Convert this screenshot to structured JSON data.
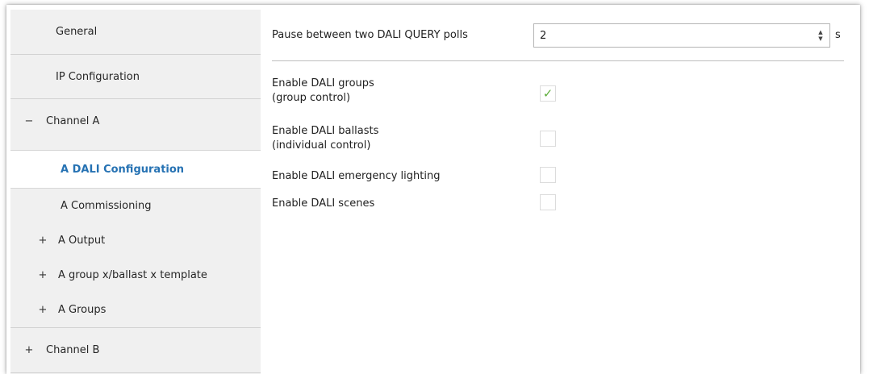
{
  "sidebar": {
    "items": [
      {
        "label": "General"
      },
      {
        "label": "IP Configuration"
      },
      {
        "label": "Channel A",
        "expander": "−"
      },
      {
        "label": "A DALI Configuration"
      },
      {
        "label": "A Commissioning"
      },
      {
        "label": "A Output",
        "expander": "+"
      },
      {
        "label": "A group x/ballast x template",
        "expander": "+"
      },
      {
        "label": "A Groups",
        "expander": "+"
      },
      {
        "label": "Channel B",
        "expander": "+"
      }
    ]
  },
  "content": {
    "pause": {
      "label": "Pause between two DALI QUERY polls",
      "value": "2",
      "unit": "s",
      "spin_up": "▲",
      "spin_down": "▼"
    },
    "options": [
      {
        "label_line1": "Enable DALI groups",
        "label_line2": "(group control)",
        "checked": true
      },
      {
        "label_line1": "Enable DALI ballasts",
        "label_line2": "(individual control)",
        "checked": false
      },
      {
        "label_line1": "Enable DALI emergency lighting",
        "checked": false
      },
      {
        "label_line1": "Enable DALI scenes",
        "checked": false
      }
    ],
    "check_glyph": "✓",
    "check_color": "#5fae3d",
    "selected_color": "#2672b3"
  }
}
